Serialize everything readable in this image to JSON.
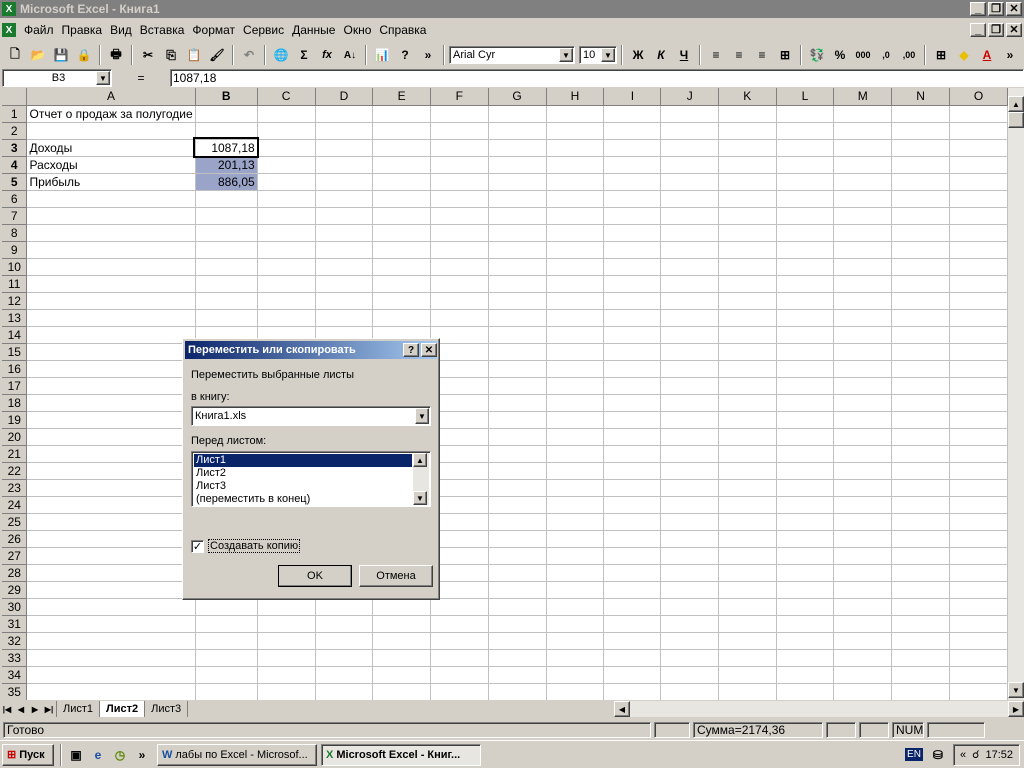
{
  "window": {
    "title": "Microsoft Excel - Книга1"
  },
  "menu": [
    "Файл",
    "Правка",
    "Вид",
    "Вставка",
    "Формат",
    "Сервис",
    "Данные",
    "Окно",
    "Справка"
  ],
  "toolbar": {
    "font": "Arial Cyr",
    "size": "10",
    "bold": "Ж",
    "italic": "К",
    "underline": "Ч",
    "percent": "%",
    "thousands": "000",
    "sigma": "Σ",
    "fx": "fx"
  },
  "formula_bar": {
    "name_box": "B3",
    "equals": "=",
    "value": "1087,18"
  },
  "columns": [
    "A",
    "B",
    "C",
    "D",
    "E",
    "F",
    "G",
    "H",
    "I",
    "J",
    "K",
    "L",
    "M",
    "N",
    "O"
  ],
  "rows": [
    "1",
    "2",
    "3",
    "4",
    "5",
    "6",
    "7",
    "8",
    "9",
    "10",
    "11",
    "12",
    "13",
    "14",
    "15",
    "16",
    "17",
    "18",
    "19",
    "20",
    "21",
    "22",
    "23",
    "24",
    "25",
    "26",
    "27",
    "28",
    "29",
    "30",
    "31",
    "32",
    "33",
    "34",
    "35"
  ],
  "cells": {
    "a1": "Отчет о продаж за полугодие",
    "a3": "Доходы",
    "b3": "1087,18",
    "a4": "Расходы",
    "b4": "201,13",
    "a5": "Прибыль",
    "b5": "886,05"
  },
  "sheet_tabs": [
    "Лист1",
    "Лист2",
    "Лист3"
  ],
  "status": {
    "ready": "Готово",
    "sum": "Сумма=2174,36",
    "num": "NUM"
  },
  "dialog": {
    "title": "Переместить или скопировать",
    "help": "?",
    "move_label": "Переместить выбранные листы",
    "book_label": "в книгу:",
    "book_value": "Книга1.xls",
    "before_label": "Перед листом:",
    "sheets": [
      "Лист1",
      "Лист2",
      "Лист3",
      "(переместить в конец)"
    ],
    "copy_label": "Создавать копию",
    "ok": "OK",
    "cancel": "Отмена"
  },
  "taskbar": {
    "start": "Пуск",
    "task1": "лабы по Excel - Microsof...",
    "task2": "Microsoft Excel - Книг...",
    "lang": "EN",
    "time": "17:52"
  }
}
